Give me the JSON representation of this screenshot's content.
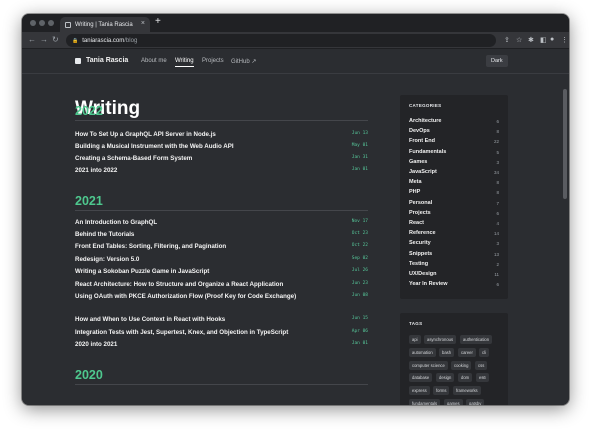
{
  "browser": {
    "tab_title": "Writing | Tania Rascia",
    "tab_close": "×",
    "new_tab": "+",
    "url_host": "taniarascia.com",
    "url_path": "/blog",
    "back": "←",
    "forward": "→",
    "reload": "↻",
    "lock": "🔒"
  },
  "site": {
    "brand": "Tania Rascia",
    "nav": [
      "About me",
      "Writing",
      "Projects",
      "GitHub ↗"
    ],
    "theme_button": "Dark"
  },
  "page_title": "Writing",
  "years": [
    {
      "year": "2022",
      "posts": [
        {
          "title": "How To Set Up a GraphQL API Server in Node.js",
          "date": "Jun 13"
        },
        {
          "title": "Building a Musical Instrument with the Web Audio API",
          "date": "May 01"
        },
        {
          "title": "Creating a Schema-Based Form System",
          "date": "Jan 31"
        },
        {
          "title": "2021 into 2022",
          "date": "Jan 01"
        }
      ]
    },
    {
      "year": "2021",
      "posts": [
        {
          "title": "An Introduction to GraphQL",
          "date": "Nov 17"
        },
        {
          "title": "Behind the Tutorials",
          "date": "Oct 23"
        },
        {
          "title": "Front End Tables: Sorting, Filtering, and Pagination",
          "date": "Oct 22"
        },
        {
          "title": "Redesign: Version 5.0",
          "date": "Sep 02"
        },
        {
          "title": "Writing a Sokoban Puzzle Game in JavaScript",
          "date": "Jul 26"
        },
        {
          "title": "React Architecture: How to Structure and Organize a React Application",
          "date": "Jun 23"
        },
        {
          "title": "Using OAuth with PKCE Authorization Flow (Proof Key for Code Exchange)",
          "date": "Jun 08"
        },
        {
          "title": "How and When to Use Context in React with Hooks",
          "date": "Jun 15"
        },
        {
          "title": "Integration Tests with Jest, Supertest, Knex, and Objection in TypeScript",
          "date": "Apr 06"
        },
        {
          "title": "2020 into 2021",
          "date": "Jan 01"
        }
      ]
    },
    {
      "year": "2020",
      "posts": []
    }
  ],
  "sidebar": {
    "categories_heading": "CATEGORIES",
    "categories": [
      {
        "name": "Architecture",
        "count": "6"
      },
      {
        "name": "DevOps",
        "count": "8"
      },
      {
        "name": "Front End",
        "count": "22"
      },
      {
        "name": "Fundamentals",
        "count": "5"
      },
      {
        "name": "Games",
        "count": "3"
      },
      {
        "name": "JavaScript",
        "count": "34"
      },
      {
        "name": "Meta",
        "count": "8"
      },
      {
        "name": "PHP",
        "count": "8"
      },
      {
        "name": "Personal",
        "count": "7"
      },
      {
        "name": "Projects",
        "count": "6"
      },
      {
        "name": "React",
        "count": "4"
      },
      {
        "name": "Reference",
        "count": "14"
      },
      {
        "name": "Security",
        "count": "3"
      },
      {
        "name": "Snippets",
        "count": "13"
      },
      {
        "name": "Testing",
        "count": "2"
      },
      {
        "name": "UX/Design",
        "count": "11"
      },
      {
        "name": "Year In Review",
        "count": "6"
      }
    ],
    "tags_heading": "TAGS",
    "tags": [
      [
        "api",
        "asynchronous",
        "authentication"
      ],
      [
        "automation",
        "bash",
        "career",
        "cli"
      ],
      [
        "computer science",
        "cooking",
        "css"
      ],
      [
        "database",
        "design",
        "dom",
        "es6"
      ],
      [
        "express",
        "forms",
        "frameworks"
      ],
      [
        "fundamentals",
        "games",
        "gatsby"
      ]
    ]
  },
  "colors": {
    "accent_green": "#4ec88e",
    "page_bg": "#2b2d31",
    "sidebar_bg": "#232427"
  }
}
